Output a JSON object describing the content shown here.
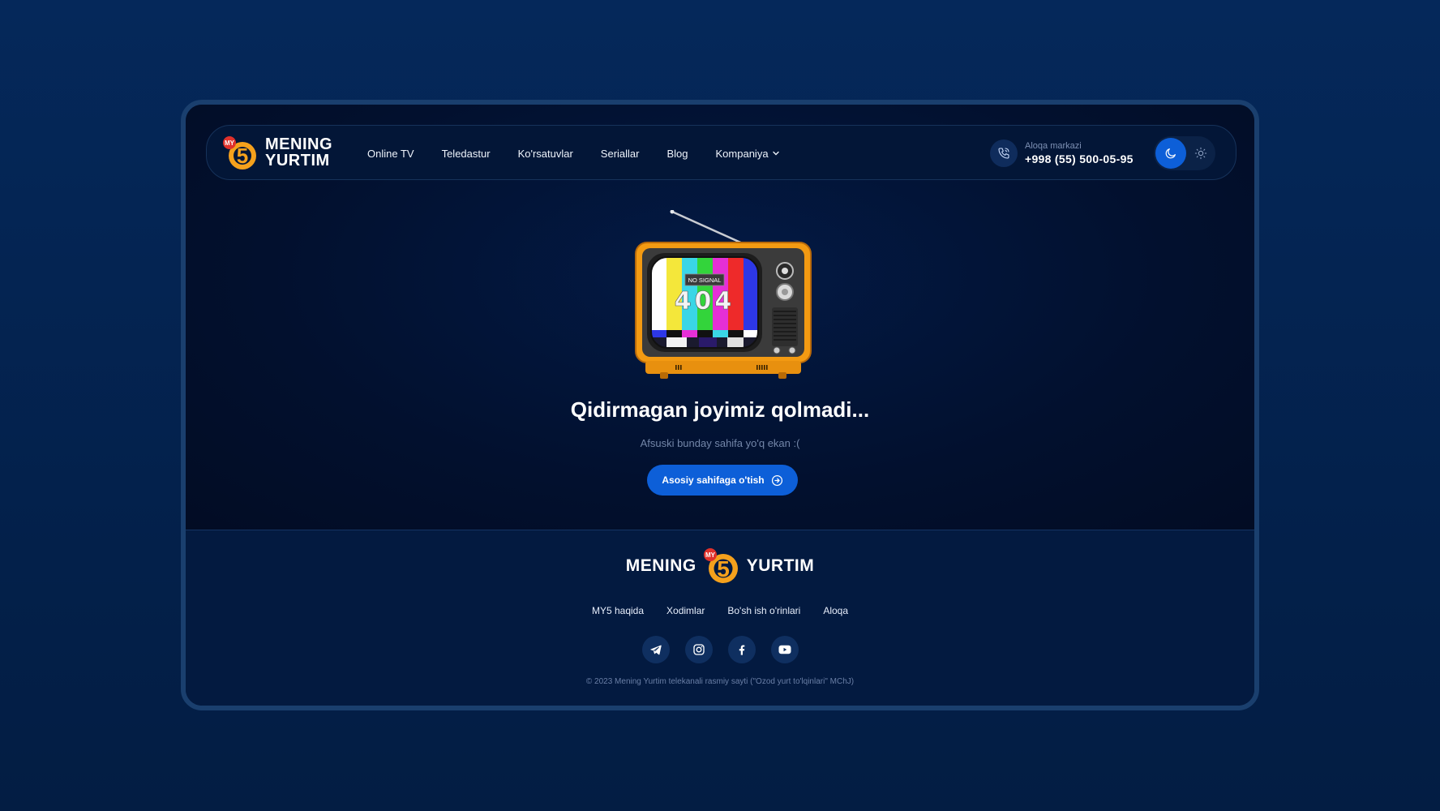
{
  "header": {
    "logo": {
      "badge": "MY",
      "numeral": "5",
      "line1": "MENING",
      "line2": "YURTIM"
    },
    "nav": [
      {
        "label": "Online TV"
      },
      {
        "label": "Teledastur"
      },
      {
        "label": "Ko'rsatuvlar"
      },
      {
        "label": "Seriallar"
      },
      {
        "label": "Blog"
      },
      {
        "label": "Kompaniya"
      }
    ],
    "contact": {
      "label": "Aloqa markazi",
      "phone": "+998 (55) 500-05-95"
    },
    "theme": {
      "active": "dark",
      "icons": [
        "moon-icon",
        "sun-icon"
      ]
    }
  },
  "error": {
    "tv_label": "NO SIGNAL",
    "code": "404",
    "title": "Qidirmagan joyimiz qolmadi...",
    "subtitle": "Afsuski bunday sahifa yo'q ekan :(",
    "button_label": "Asosiy sahifaga o'tish"
  },
  "footer": {
    "logo": {
      "left": "MENING",
      "right": "YURTIM",
      "badge": "MY",
      "numeral": "5"
    },
    "links": [
      {
        "label": "MY5 haqida"
      },
      {
        "label": "Xodimlar"
      },
      {
        "label": "Bo'sh ish o'rinlari"
      },
      {
        "label": "Aloqa"
      }
    ],
    "socials": [
      "telegram-icon",
      "instagram-icon",
      "facebook-icon",
      "youtube-icon"
    ],
    "copyright": "© 2023 Mening Yurtim telekanali rasmiy sayti (\"Ozod yurt to'lqinlari\" MChJ)"
  },
  "colors": {
    "background": "#03214c",
    "frame_border": "#1a3f6e",
    "page": "#020f2c",
    "accent": "#0d5fd8",
    "logo_orange": "#f5a11c",
    "badge_red": "#e0312b"
  }
}
